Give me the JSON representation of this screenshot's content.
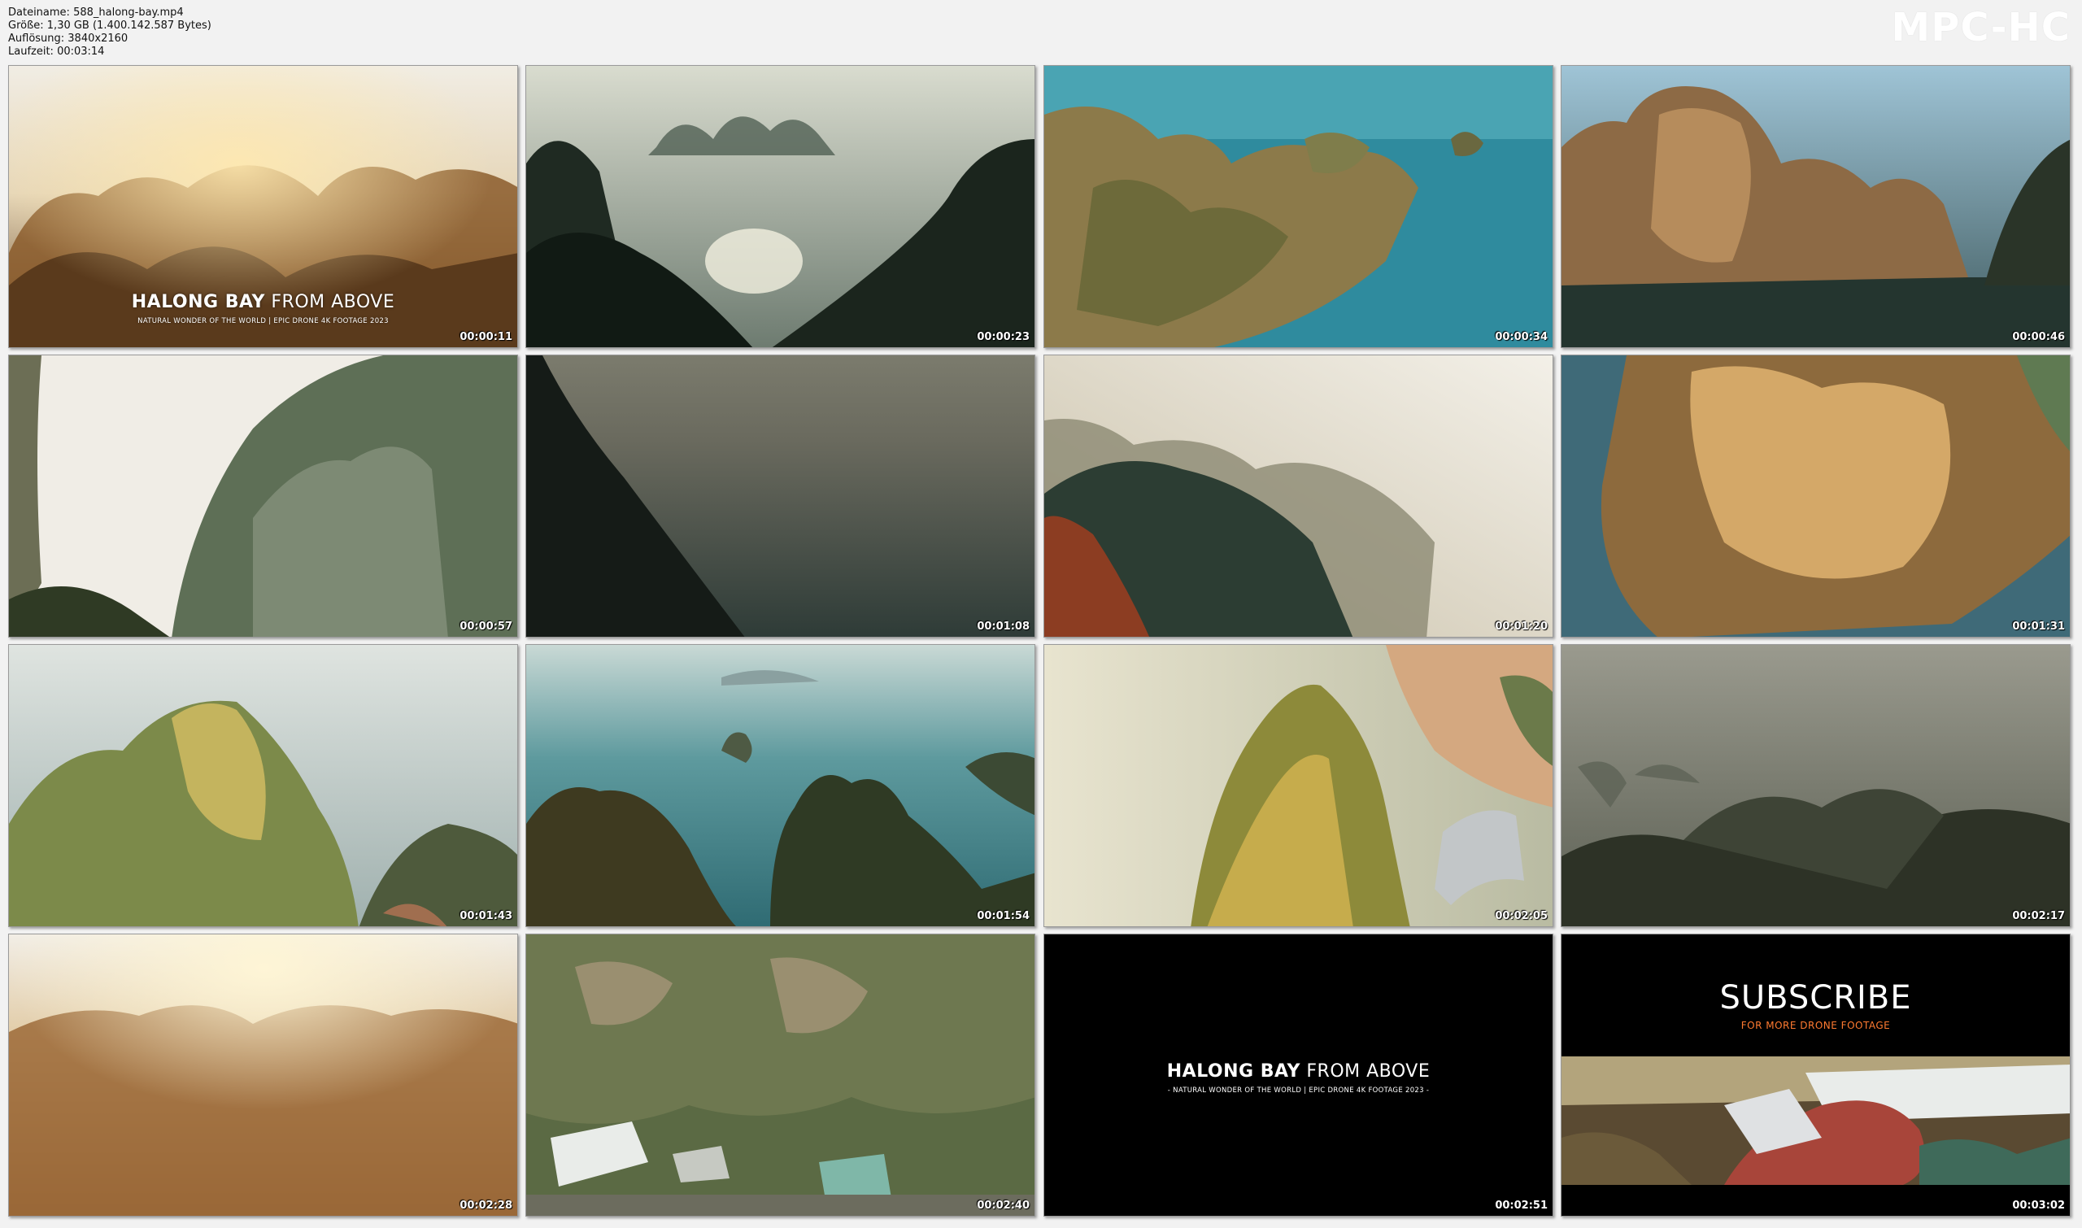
{
  "file_info": {
    "filename": "Dateiname: 588_halong-bay.mp4",
    "size": "Größe: 1,30 GB (1.400.142.587 Bytes)",
    "resolution": "Auflösung: 3840x2160",
    "duration": "Laufzeit: 00:03:14"
  },
  "logo": "MPC-HC",
  "overlay": {
    "title_bold": "HALONG BAY",
    "title_light": "FROM ABOVE",
    "subtitle": "NATURAL WONDER OF THE WORLD | EPIC DRONE 4K FOOTAGE 2023",
    "end_subtitle": "- NATURAL WONDER OF THE WORLD | EPIC DRONE 4K FOOTAGE 2023 -"
  },
  "subscribe": {
    "title": "SUBSCRIBE",
    "caption": "FOR MORE DRONE FOOTAGE"
  },
  "thumbnails": [
    {
      "time": "00:00:11"
    },
    {
      "time": "00:00:23"
    },
    {
      "time": "00:00:34"
    },
    {
      "time": "00:00:46"
    },
    {
      "time": "00:00:57"
    },
    {
      "time": "00:01:08"
    },
    {
      "time": "00:01:20"
    },
    {
      "time": "00:01:31"
    },
    {
      "time": "00:01:43"
    },
    {
      "time": "00:01:54"
    },
    {
      "time": "00:02:05"
    },
    {
      "time": "00:02:17"
    },
    {
      "time": "00:02:28"
    },
    {
      "time": "00:02:40"
    },
    {
      "time": "00:02:51"
    },
    {
      "time": "00:03:02"
    }
  ]
}
